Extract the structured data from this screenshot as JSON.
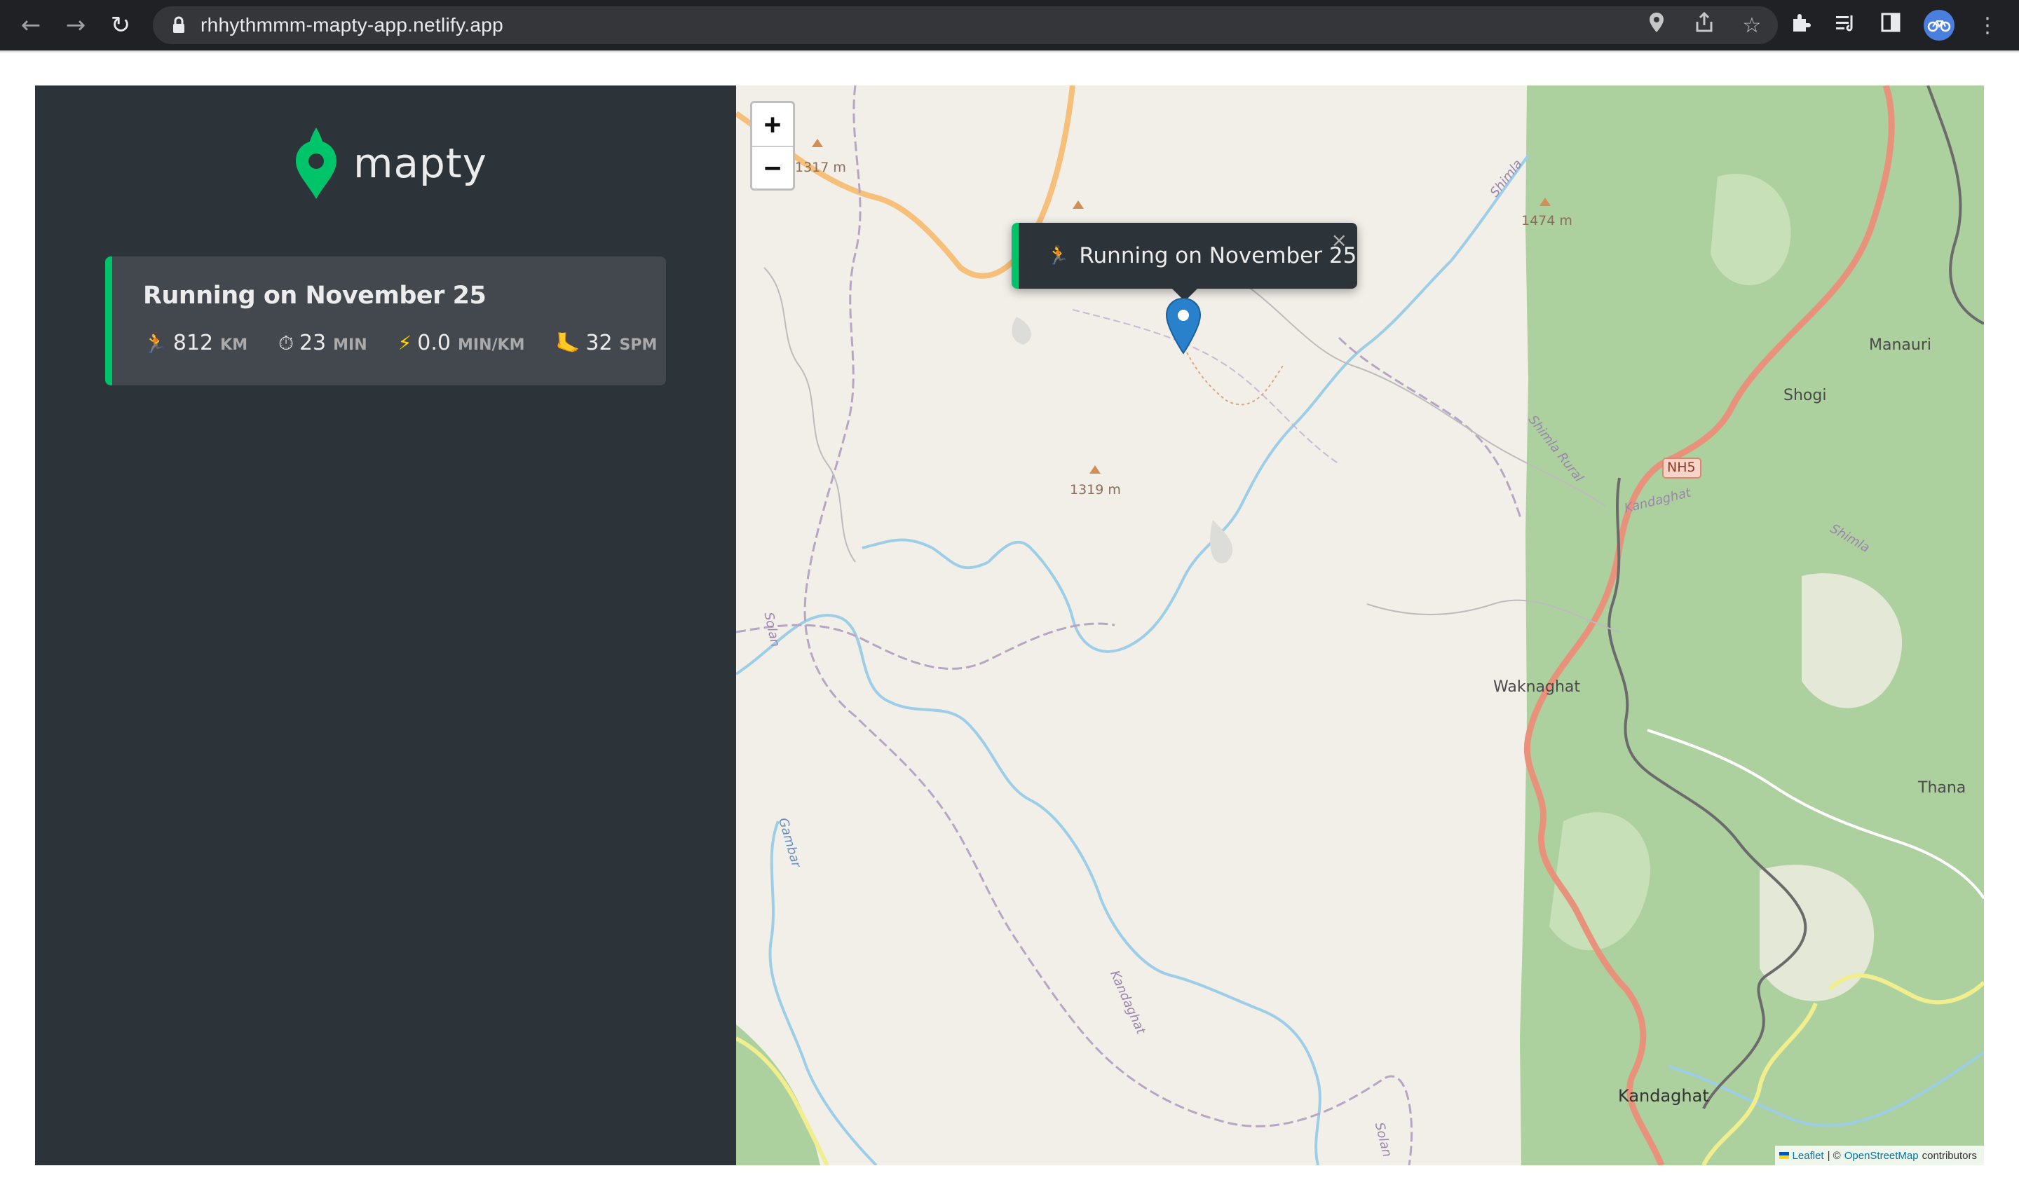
{
  "browser": {
    "url": "rhhythmmm-mapty-app.netlify.app",
    "icons": [
      "back-arrow-icon",
      "forward-arrow-icon",
      "reload-icon",
      "lock-icon",
      "location-icon",
      "share-icon",
      "star-icon",
      "extensions-icon",
      "reading-list-icon",
      "side-panel-icon",
      "profile-avatar",
      "more-menu-icon"
    ]
  },
  "app": {
    "logo_text": "mapty",
    "brand_color": "#00c46a",
    "sidebar_color": "#2d3439"
  },
  "workouts": [
    {
      "title": "Running on November 25",
      "type": "running",
      "distance": "812",
      "distance_unit": "KM",
      "duration": "23",
      "duration_unit": "MIN",
      "pace": "0.0",
      "pace_unit": "MIN/KM",
      "cadence": "32",
      "cadence_unit": "SPM",
      "icons": [
        "runner-emoji",
        "stopwatch-emoji",
        "lightning-emoji",
        "footprint-emoji"
      ]
    }
  ],
  "map": {
    "zoom_in": "+",
    "zoom_out": "−",
    "popup_text": "Running on November 25",
    "popup_close": "×",
    "labels": {
      "elev1": "1317 m",
      "elev2": "1319 m",
      "elev3": "1474 m",
      "manauri": "Manauri",
      "shogi": "Shogi",
      "nh5": "NH5",
      "shimla_rural": "Shimla Rural",
      "kandaghat_road": "Kandaghat",
      "shimla1": "Shimla",
      "shimla2": "Shimla",
      "waknaghat": "Waknaghat",
      "thana": "Thana",
      "kandaghat": "Kandaghat",
      "solan1": "Solan",
      "solan2": "Solan",
      "kandaghat_river": "Kandaghat",
      "gambar": "Gambar"
    },
    "attribution": {
      "leaflet": "Leaflet",
      "sep": "| ©",
      "osm": "OpenStreetMap",
      "contributors": "contributors"
    }
  }
}
